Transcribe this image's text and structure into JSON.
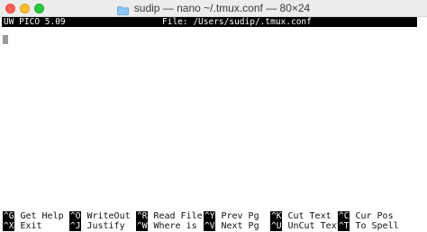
{
  "window": {
    "title": "sudip — nano ~/.tmux.conf — 80×24",
    "traffic_lights": {
      "close_color": "#ff5f57",
      "minimize_color": "#febc2e",
      "zoom_color": "#28c840"
    },
    "title_icon": "folder-icon"
  },
  "editor": {
    "version_label": "UW PICO 5.09",
    "file_label": "File: /Users/sudip/.tmux.conf"
  },
  "shortcuts": {
    "row1": [
      {
        "key": "^G",
        "label": "Get Help"
      },
      {
        "key": "^O",
        "label": "WriteOut"
      },
      {
        "key": "^R",
        "label": "Read File"
      },
      {
        "key": "^Y",
        "label": "Prev Pg"
      },
      {
        "key": "^K",
        "label": "Cut Text"
      },
      {
        "key": "^C",
        "label": "Cur Pos"
      }
    ],
    "row2": [
      {
        "key": "^X",
        "label": "Exit"
      },
      {
        "key": "^J",
        "label": "Justify"
      },
      {
        "key": "^W",
        "label": "Where is"
      },
      {
        "key": "^V",
        "label": "Next Pg"
      },
      {
        "key": "^U",
        "label": "UnCut Text"
      },
      {
        "key": "^T",
        "label": "To Spell"
      }
    ]
  }
}
